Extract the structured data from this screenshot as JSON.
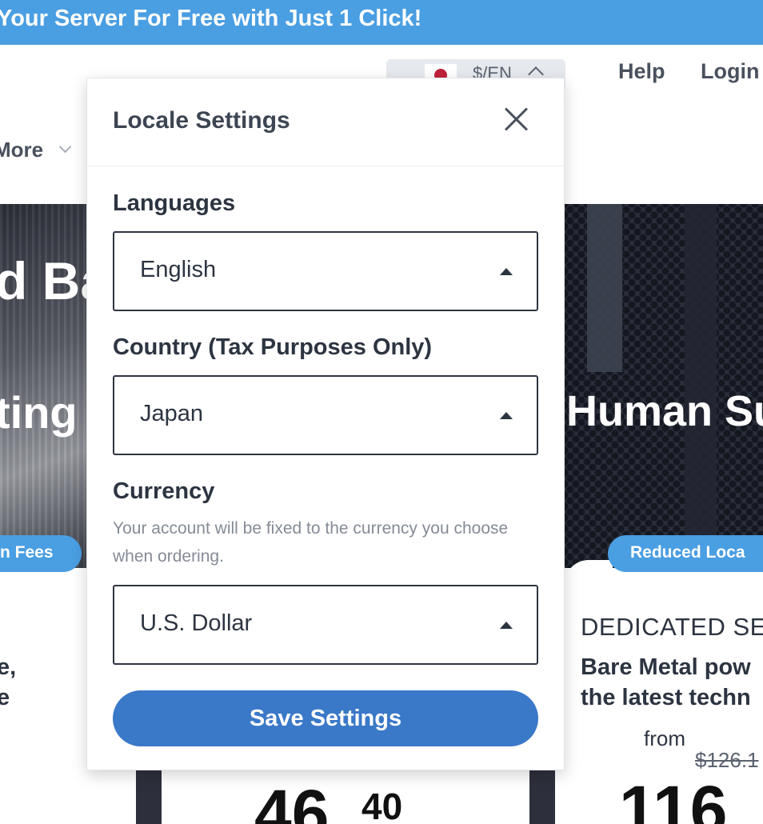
{
  "banner": {
    "text": "Your Server For Free with Just 1 Click!"
  },
  "header": {
    "locale_label": "$/EN",
    "help": "Help",
    "login": "Login",
    "more": "More"
  },
  "hero": {
    "left_line1": "d Ba",
    "left_line2": "ting",
    "right_line": "Human Su",
    "left_badge": "n Fees",
    "right_badge": "Reduced Loca"
  },
  "background": {
    "left_text1": "e,",
    "left_text2": "e",
    "dedicated_title": "DEDICATED SE",
    "dedicated_desc1": "Bare Metal pow",
    "dedicated_desc2": "the latest techn",
    "from": "from",
    "old_price": "$126.1",
    "price_left_main": "46",
    "price_left_sup": "40",
    "price_right_main": "116"
  },
  "modal": {
    "title": "Locale Settings",
    "languages_label": "Languages",
    "language_value": "English",
    "country_label": "Country (Tax Purposes Only)",
    "country_value": "Japan",
    "currency_label": "Currency",
    "currency_hint": "Your account will be fixed to the currency you choose when ordering.",
    "currency_value": "U.S. Dollar",
    "save_label": "Save Settings"
  },
  "colors": {
    "banner_blue": "#4a9ee2",
    "save_button": "#3a78c8",
    "text_dark": "#2d3441",
    "flag_red": "#c0223a"
  },
  "icons": [
    "japan-flag-icon",
    "chevron-up-icon",
    "chevron-down-icon",
    "close-icon",
    "caret-up-icon"
  ]
}
